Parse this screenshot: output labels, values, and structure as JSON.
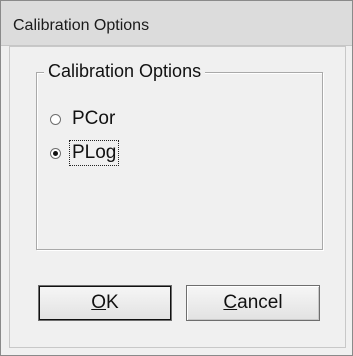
{
  "window": {
    "title": "Calibration Options"
  },
  "group": {
    "legend": "Calibration Options"
  },
  "options": [
    {
      "label": "PCor",
      "selected": false
    },
    {
      "label": "PLog",
      "selected": true
    }
  ],
  "buttons": {
    "ok_mnemonic": "O",
    "ok_rest": "K",
    "cancel_mnemonic": "C",
    "cancel_rest": "ancel"
  }
}
